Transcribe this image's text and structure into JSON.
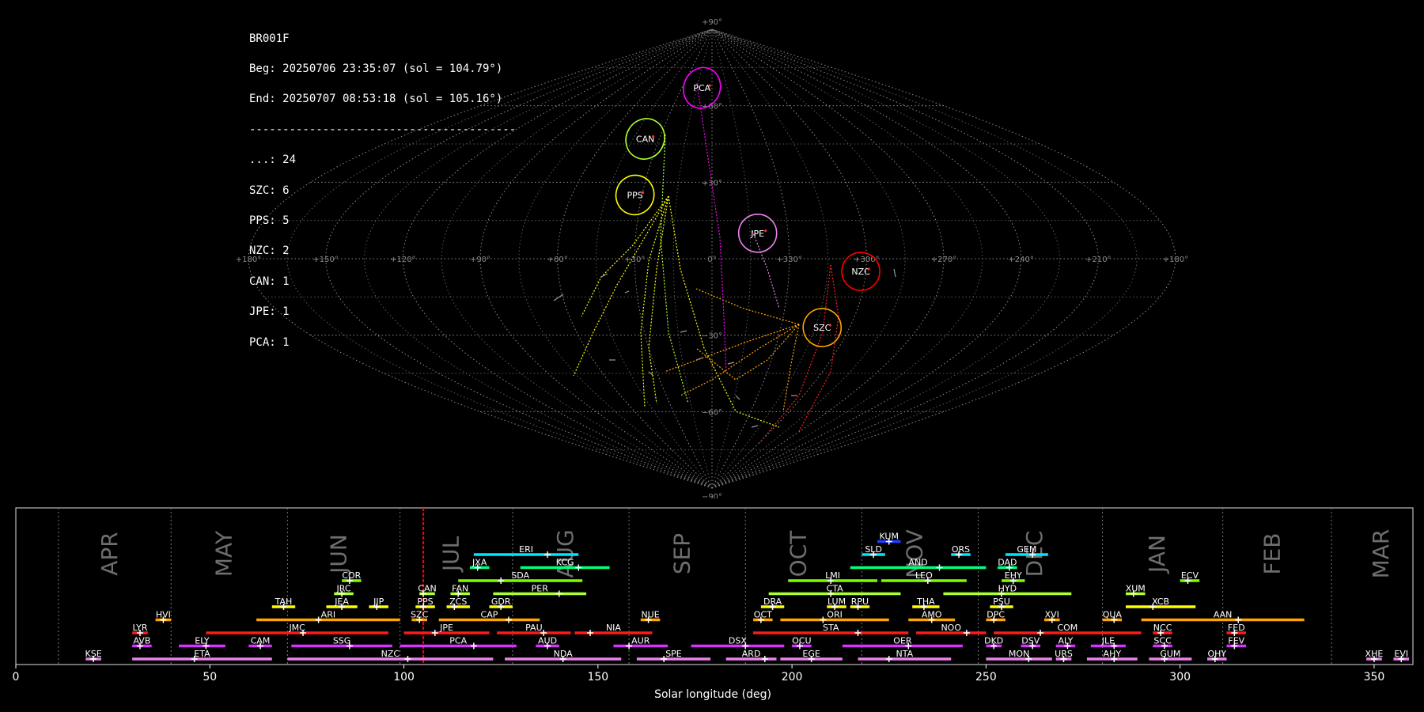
{
  "info": {
    "station": "BR001F",
    "begin": "Beg: 20250706 23:35:07 (sol = 104.79°)",
    "end": "End: 20250707 08:53:18 (sol = 105.16°)",
    "separator": "----------------------------------------",
    "counts": [
      "...: 24",
      "SZC: 6",
      "PPS: 5",
      "NZC: 2",
      "CAN: 1",
      "JPE: 1",
      "PCA: 1"
    ]
  },
  "chart_data": [
    {
      "type": "scatter",
      "projection": "sinusoidal",
      "title": "",
      "lat_ticks": [
        "+90°",
        "+60°",
        "+30°",
        "0°",
        "−30°",
        "−60°",
        "−90°"
      ],
      "lon_ticks": [
        "+180°",
        "+150°",
        "+120°",
        "+90°",
        "+60°",
        "+30°",
        "0°",
        "+330°",
        "+300°",
        "+270°",
        "+240°",
        "+210°",
        "+180°"
      ],
      "radiants": [
        {
          "name": "PCA",
          "x": -10,
          "y": 67,
          "color": "#ff00ff"
        },
        {
          "name": "CAN",
          "x": -38,
          "y": 47,
          "color": "#adff2f"
        },
        {
          "name": "PPS",
          "x": -33,
          "y": 25,
          "color": "#ffff00"
        },
        {
          "name": "JPE",
          "x": 18,
          "y": 10,
          "color": "#ee82ee"
        },
        {
          "name": "NZC",
          "x": 58,
          "y": -5,
          "color": "#ff0000"
        },
        {
          "name": "SZC",
          "x": 48,
          "y": -27,
          "color": "#ffa500"
        }
      ]
    },
    {
      "type": "timeline",
      "xlabel": "Solar longitude (deg)",
      "xlim": [
        0,
        360
      ],
      "xticks": [
        0,
        50,
        100,
        150,
        200,
        250,
        300,
        350
      ],
      "current_sol": 105,
      "months": [
        {
          "label": "APR",
          "start": 11
        },
        {
          "label": "MAY",
          "start": 40
        },
        {
          "label": "JUN",
          "start": 70
        },
        {
          "label": "JUL",
          "start": 99
        },
        {
          "label": "AUG",
          "start": 128
        },
        {
          "label": "SEP",
          "start": 158
        },
        {
          "label": "OCT",
          "start": 188
        },
        {
          "label": "NOV",
          "start": 218
        },
        {
          "label": "DEC",
          "start": 248
        },
        {
          "label": "JAN",
          "start": 280
        },
        {
          "label": "FEB",
          "start": 311
        },
        {
          "label": "MAR",
          "start": 339
        }
      ],
      "showers": [
        {
          "code": "KUM",
          "start": 222,
          "end": 228,
          "peak": 225,
          "row": 9,
          "color": "#1e40ff"
        },
        {
          "code": "ERI",
          "start": 118,
          "end": 145,
          "peak": 137,
          "row": 8,
          "color": "#00e5ff"
        },
        {
          "code": "SLD",
          "start": 218,
          "end": 224,
          "peak": 221,
          "row": 8,
          "color": "#00e5ff"
        },
        {
          "code": "ORS",
          "start": 241,
          "end": 246,
          "peak": 243,
          "row": 8,
          "color": "#00e5ff"
        },
        {
          "code": "GEM",
          "start": 255,
          "end": 266,
          "peak": 262,
          "row": 8,
          "color": "#00e5ff"
        },
        {
          "code": "JXA",
          "start": 117,
          "end": 122,
          "peak": 119,
          "row": 7,
          "color": "#00ff7f"
        },
        {
          "code": "KCG",
          "start": 130,
          "end": 153,
          "peak": 145,
          "row": 7,
          "color": "#00ff7f"
        },
        {
          "code": "AND",
          "start": 215,
          "end": 250,
          "peak": 238,
          "row": 7,
          "color": "#00ff7f"
        },
        {
          "code": "DAD",
          "start": 253,
          "end": 258,
          "peak": 256,
          "row": 7,
          "color": "#00ff7f"
        },
        {
          "code": "COR",
          "start": 84,
          "end": 89,
          "peak": 86,
          "row": 6,
          "color": "#7cfc00"
        },
        {
          "code": "SDA",
          "start": 114,
          "end": 146,
          "peak": 125,
          "row": 6,
          "color": "#7cfc00"
        },
        {
          "code": "LMI",
          "start": 199,
          "end": 222,
          "peak": 210,
          "row": 6,
          "color": "#7cfc00"
        },
        {
          "code": "LEO",
          "start": 223,
          "end": 245,
          "peak": 235,
          "row": 6,
          "color": "#7cfc00"
        },
        {
          "code": "EHY",
          "start": 254,
          "end": 260,
          "peak": 257,
          "row": 6,
          "color": "#7cfc00"
        },
        {
          "code": "ECV",
          "start": 300,
          "end": 305,
          "peak": 302,
          "row": 6,
          "color": "#7cfc00"
        },
        {
          "code": "JRC",
          "start": 82,
          "end": 87,
          "peak": 84,
          "row": 5,
          "color": "#adff2f"
        },
        {
          "code": "CAN",
          "start": 104,
          "end": 108,
          "peak": 105,
          "row": 5,
          "color": "#adff2f"
        },
        {
          "code": "FAN",
          "start": 112,
          "end": 117,
          "peak": 114,
          "row": 5,
          "color": "#adff2f"
        },
        {
          "code": "PER",
          "start": 123,
          "end": 147,
          "peak": 140,
          "row": 5,
          "color": "#adff2f"
        },
        {
          "code": "CTA",
          "start": 194,
          "end": 228,
          "peak": 210,
          "row": 5,
          "color": "#adff2f"
        },
        {
          "code": "HYD",
          "start": 239,
          "end": 272,
          "peak": 254,
          "row": 5,
          "color": "#adff2f"
        },
        {
          "code": "XUM",
          "start": 286,
          "end": 291,
          "peak": 288,
          "row": 5,
          "color": "#adff2f"
        },
        {
          "code": "TAH",
          "start": 66,
          "end": 72,
          "peak": 69,
          "row": 4,
          "color": "#ffff00"
        },
        {
          "code": "JEA",
          "start": 80,
          "end": 88,
          "peak": 84,
          "row": 4,
          "color": "#ffff00"
        },
        {
          "code": "JIP",
          "start": 91,
          "end": 96,
          "peak": 93,
          "row": 4,
          "color": "#ffff00"
        },
        {
          "code": "PPS",
          "start": 103,
          "end": 108,
          "peak": 105,
          "row": 4,
          "color": "#ffff00"
        },
        {
          "code": "ZCS",
          "start": 111,
          "end": 117,
          "peak": 113,
          "row": 4,
          "color": "#ffff00"
        },
        {
          "code": "GDR",
          "start": 122,
          "end": 128,
          "peak": 125,
          "row": 4,
          "color": "#ffff00"
        },
        {
          "code": "DRA",
          "start": 192,
          "end": 198,
          "peak": 195,
          "row": 4,
          "color": "#ffff00"
        },
        {
          "code": "LUM",
          "start": 209,
          "end": 214,
          "peak": 211,
          "row": 4,
          "color": "#ffff00"
        },
        {
          "code": "RPU",
          "start": 215,
          "end": 220,
          "peak": 217,
          "row": 4,
          "color": "#ffff00"
        },
        {
          "code": "THA",
          "start": 231,
          "end": 238,
          "peak": 234,
          "row": 4,
          "color": "#ffff00"
        },
        {
          "code": "PSU",
          "start": 251,
          "end": 257,
          "peak": 254,
          "row": 4,
          "color": "#ffff00"
        },
        {
          "code": "XCB",
          "start": 286,
          "end": 304,
          "peak": 293,
          "row": 4,
          "color": "#ffff00"
        },
        {
          "code": "HVI",
          "start": 36,
          "end": 40,
          "peak": 38,
          "row": 3,
          "color": "#ffa500"
        },
        {
          "code": "ARI",
          "start": 62,
          "end": 99,
          "peak": 78,
          "row": 3,
          "color": "#ffa500"
        },
        {
          "code": "SZC",
          "start": 102,
          "end": 106,
          "peak": 104,
          "row": 3,
          "color": "#ffa500"
        },
        {
          "code": "CAP",
          "start": 109,
          "end": 135,
          "peak": 127,
          "row": 3,
          "color": "#ffa500"
        },
        {
          "code": "NUE",
          "start": 161,
          "end": 166,
          "peak": 163,
          "row": 3,
          "color": "#ffa500"
        },
        {
          "code": "OCT",
          "start": 190,
          "end": 195,
          "peak": 192,
          "row": 3,
          "color": "#ffa500"
        },
        {
          "code": "ORI",
          "start": 197,
          "end": 225,
          "peak": 208,
          "row": 3,
          "color": "#ffa500"
        },
        {
          "code": "AMO",
          "start": 230,
          "end": 242,
          "peak": 236,
          "row": 3,
          "color": "#ffa500"
        },
        {
          "code": "DPC",
          "start": 250,
          "end": 255,
          "peak": 252,
          "row": 3,
          "color": "#ffa500"
        },
        {
          "code": "XVI",
          "start": 265,
          "end": 269,
          "peak": 267,
          "row": 3,
          "color": "#ffa500"
        },
        {
          "code": "QUA",
          "start": 280,
          "end": 285,
          "peak": 283,
          "row": 3,
          "color": "#ffa500"
        },
        {
          "code": "AAN",
          "start": 290,
          "end": 332,
          "peak": 315,
          "row": 3,
          "color": "#ffa500"
        },
        {
          "code": "LYR",
          "start": 30,
          "end": 34,
          "peak": 32,
          "row": 2,
          "color": "#ff1a1a"
        },
        {
          "code": "JMC",
          "start": 49,
          "end": 96,
          "peak": 74,
          "row": 2,
          "color": "#ff1a1a"
        },
        {
          "code": "JPE",
          "start": 100,
          "end": 122,
          "peak": 108,
          "row": 2,
          "color": "#ff1a1a"
        },
        {
          "code": "PAU",
          "start": 124,
          "end": 143,
          "peak": 136,
          "row": 2,
          "color": "#ff1a1a"
        },
        {
          "code": "NIA",
          "start": 144,
          "end": 164,
          "peak": 148,
          "row": 2,
          "color": "#ff1a1a"
        },
        {
          "code": "STA",
          "start": 190,
          "end": 230,
          "peak": 217,
          "row": 2,
          "color": "#ff1a1a"
        },
        {
          "code": "NOO",
          "start": 232,
          "end": 250,
          "peak": 245,
          "row": 2,
          "color": "#ff1a1a"
        },
        {
          "code": "COM",
          "start": 252,
          "end": 290,
          "peak": 264,
          "row": 2,
          "color": "#ff1a1a"
        },
        {
          "code": "NCC",
          "start": 293,
          "end": 298,
          "peak": 295,
          "row": 2,
          "color": "#ff1a1a"
        },
        {
          "code": "FED",
          "start": 312,
          "end": 317,
          "peak": 314,
          "row": 2,
          "color": "#ff1a1a"
        },
        {
          "code": "AVB",
          "start": 30,
          "end": 35,
          "peak": 32,
          "row": 1,
          "color": "#d633ff"
        },
        {
          "code": "ELY",
          "start": 42,
          "end": 54,
          "peak": 49,
          "row": 1,
          "color": "#d633ff"
        },
        {
          "code": "CAM",
          "start": 60,
          "end": 66,
          "peak": 63,
          "row": 1,
          "color": "#d633ff"
        },
        {
          "code": "SSG",
          "start": 71,
          "end": 97,
          "peak": 86,
          "row": 1,
          "color": "#d633ff"
        },
        {
          "code": "PCA",
          "start": 99,
          "end": 129,
          "peak": 118,
          "row": 1,
          "color": "#d633ff"
        },
        {
          "code": "AUD",
          "start": 134,
          "end": 140,
          "peak": 137,
          "row": 1,
          "color": "#d633ff"
        },
        {
          "code": "AUR",
          "start": 154,
          "end": 168,
          "peak": 158,
          "row": 1,
          "color": "#d633ff"
        },
        {
          "code": "DSX",
          "start": 174,
          "end": 198,
          "peak": 188,
          "row": 1,
          "color": "#d633ff"
        },
        {
          "code": "OCU",
          "start": 200,
          "end": 205,
          "peak": 202,
          "row": 1,
          "color": "#d633ff"
        },
        {
          "code": "OER",
          "start": 213,
          "end": 244,
          "peak": 230,
          "row": 1,
          "color": "#d633ff"
        },
        {
          "code": "DKD",
          "start": 250,
          "end": 254,
          "peak": 252,
          "row": 1,
          "color": "#d633ff"
        },
        {
          "code": "DSV",
          "start": 259,
          "end": 264,
          "peak": 262,
          "row": 1,
          "color": "#d633ff"
        },
        {
          "code": "ALY",
          "start": 268,
          "end": 273,
          "peak": 271,
          "row": 1,
          "color": "#d633ff"
        },
        {
          "code": "JLE",
          "start": 277,
          "end": 286,
          "peak": 283,
          "row": 1,
          "color": "#d633ff"
        },
        {
          "code": "SCC",
          "start": 293,
          "end": 298,
          "peak": 296,
          "row": 1,
          "color": "#d633ff"
        },
        {
          "code": "FEV",
          "start": 312,
          "end": 317,
          "peak": 314,
          "row": 1,
          "color": "#d633ff"
        },
        {
          "code": "KSE",
          "start": 18,
          "end": 22,
          "peak": 20,
          "row": 0,
          "color": "#ee82ee"
        },
        {
          "code": "ETA",
          "start": 30,
          "end": 66,
          "peak": 46,
          "row": 0,
          "color": "#ee82ee"
        },
        {
          "code": "NZC",
          "start": 70,
          "end": 123,
          "peak": 101,
          "row": 0,
          "color": "#ee82ee"
        },
        {
          "code": "NDA",
          "start": 126,
          "end": 156,
          "peak": 141,
          "row": 0,
          "color": "#ee82ee"
        },
        {
          "code": "SPE",
          "start": 160,
          "end": 179,
          "peak": 167,
          "row": 0,
          "color": "#ee82ee"
        },
        {
          "code": "ARD",
          "start": 183,
          "end": 196,
          "peak": 193,
          "row": 0,
          "color": "#ee82ee"
        },
        {
          "code": "EGE",
          "start": 197,
          "end": 213,
          "peak": 205,
          "row": 0,
          "color": "#ee82ee"
        },
        {
          "code": "NTA",
          "start": 217,
          "end": 241,
          "peak": 225,
          "row": 0,
          "color": "#ee82ee"
        },
        {
          "code": "MON",
          "start": 250,
          "end": 267,
          "peak": 261,
          "row": 0,
          "color": "#ee82ee"
        },
        {
          "code": "URS",
          "start": 268,
          "end": 272,
          "peak": 270,
          "row": 0,
          "color": "#ee82ee"
        },
        {
          "code": "AHY",
          "start": 276,
          "end": 289,
          "peak": 283,
          "row": 0,
          "color": "#ee82ee"
        },
        {
          "code": "GUM",
          "start": 292,
          "end": 303,
          "peak": 296,
          "row": 0,
          "color": "#ee82ee"
        },
        {
          "code": "OHY",
          "start": 307,
          "end": 312,
          "peak": 309,
          "row": 0,
          "color": "#ee82ee"
        },
        {
          "code": "XHE",
          "start": 348,
          "end": 352,
          "peak": 350,
          "row": 0,
          "color": "#ee82ee"
        },
        {
          "code": "EVI",
          "start": 355,
          "end": 359,
          "peak": 357,
          "row": 0,
          "color": "#ee82ee"
        }
      ]
    }
  ]
}
